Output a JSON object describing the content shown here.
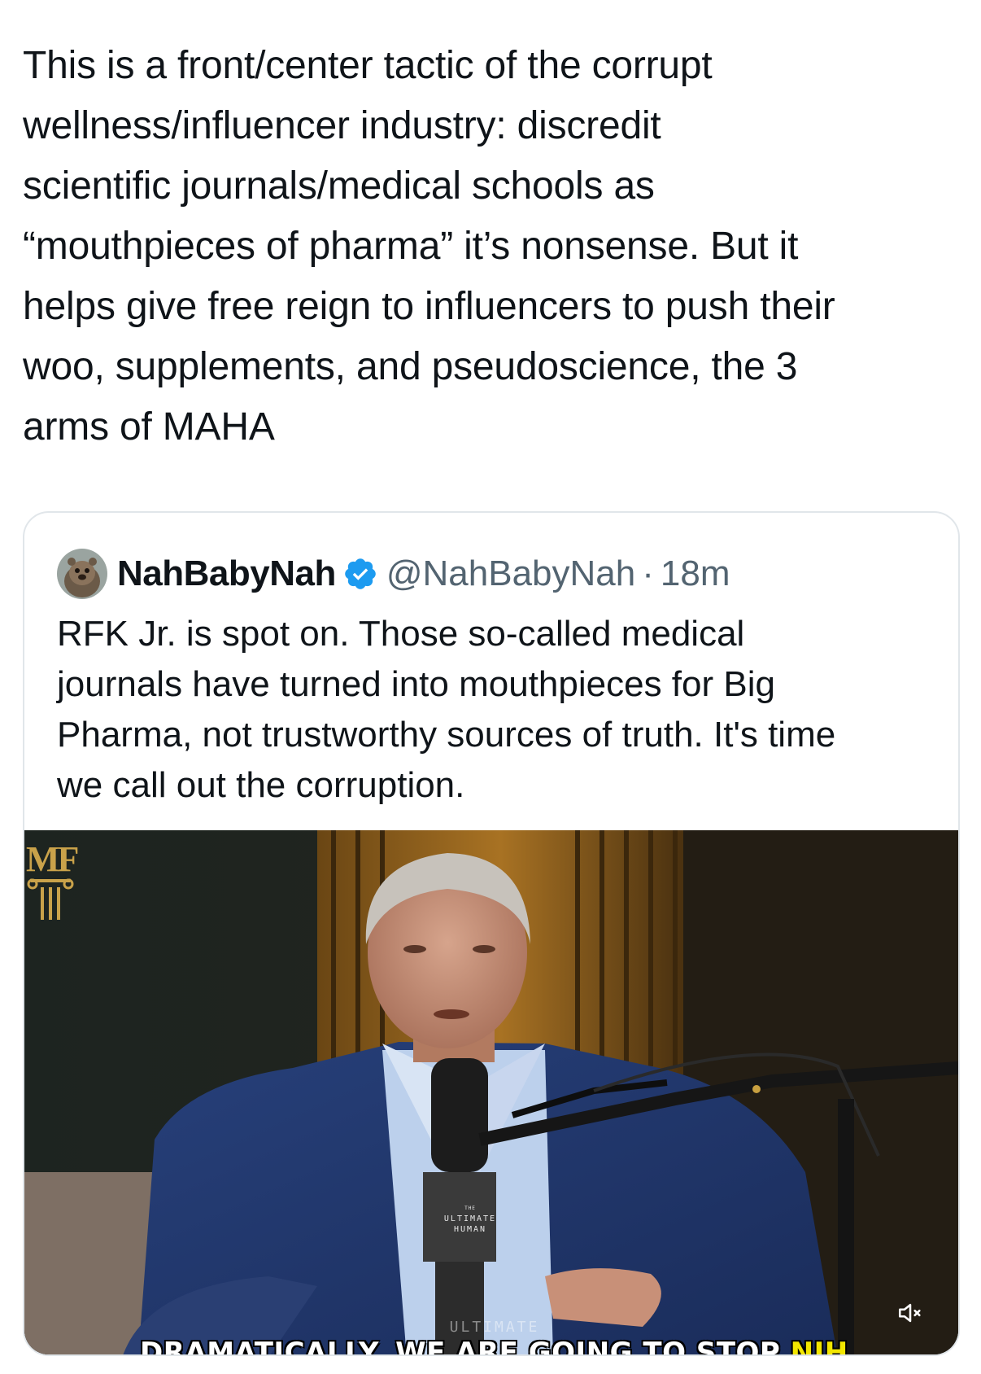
{
  "tweet": {
    "text": "This is a front/center tactic of the corrupt\nwellness/influencer industry: discredit\nscientific journals/medical schools as\n“mouthpieces of pharma” it’s nonsense. But it\nhelps give free reign to influencers to push their\nwoo, supplements, and pseudoscience, the 3\narms of MAHA"
  },
  "quoted_tweet": {
    "display_name": "NahBabyNah",
    "handle": "@NahBabyNah",
    "separator": "·",
    "time": "18m",
    "verified": true,
    "text": "RFK Jr. is spot on. Those so-called medical\njournals have turned into mouthpieces for Big\nPharma, not trustworthy sources of truth. It's time\nwe call out the corruption.",
    "media": {
      "type": "video",
      "logo_text": "MF",
      "mic_label_small": "THE",
      "mic_label_line1": "ULTIMATE",
      "mic_label_line2": "HUMAN",
      "watermark": "ULTIMATE",
      "caption_main": "DRAMATICALLY, WE ARE GOING TO STOP ",
      "caption_highlight": "NIH",
      "mute_icon": "speaker-muted-icon"
    }
  },
  "colors": {
    "text_primary": "#0f1419",
    "text_secondary": "#536471",
    "verified_blue": "#1d9bf0",
    "border": "#e1e6ea",
    "caption_highlight": "#f2e600"
  }
}
